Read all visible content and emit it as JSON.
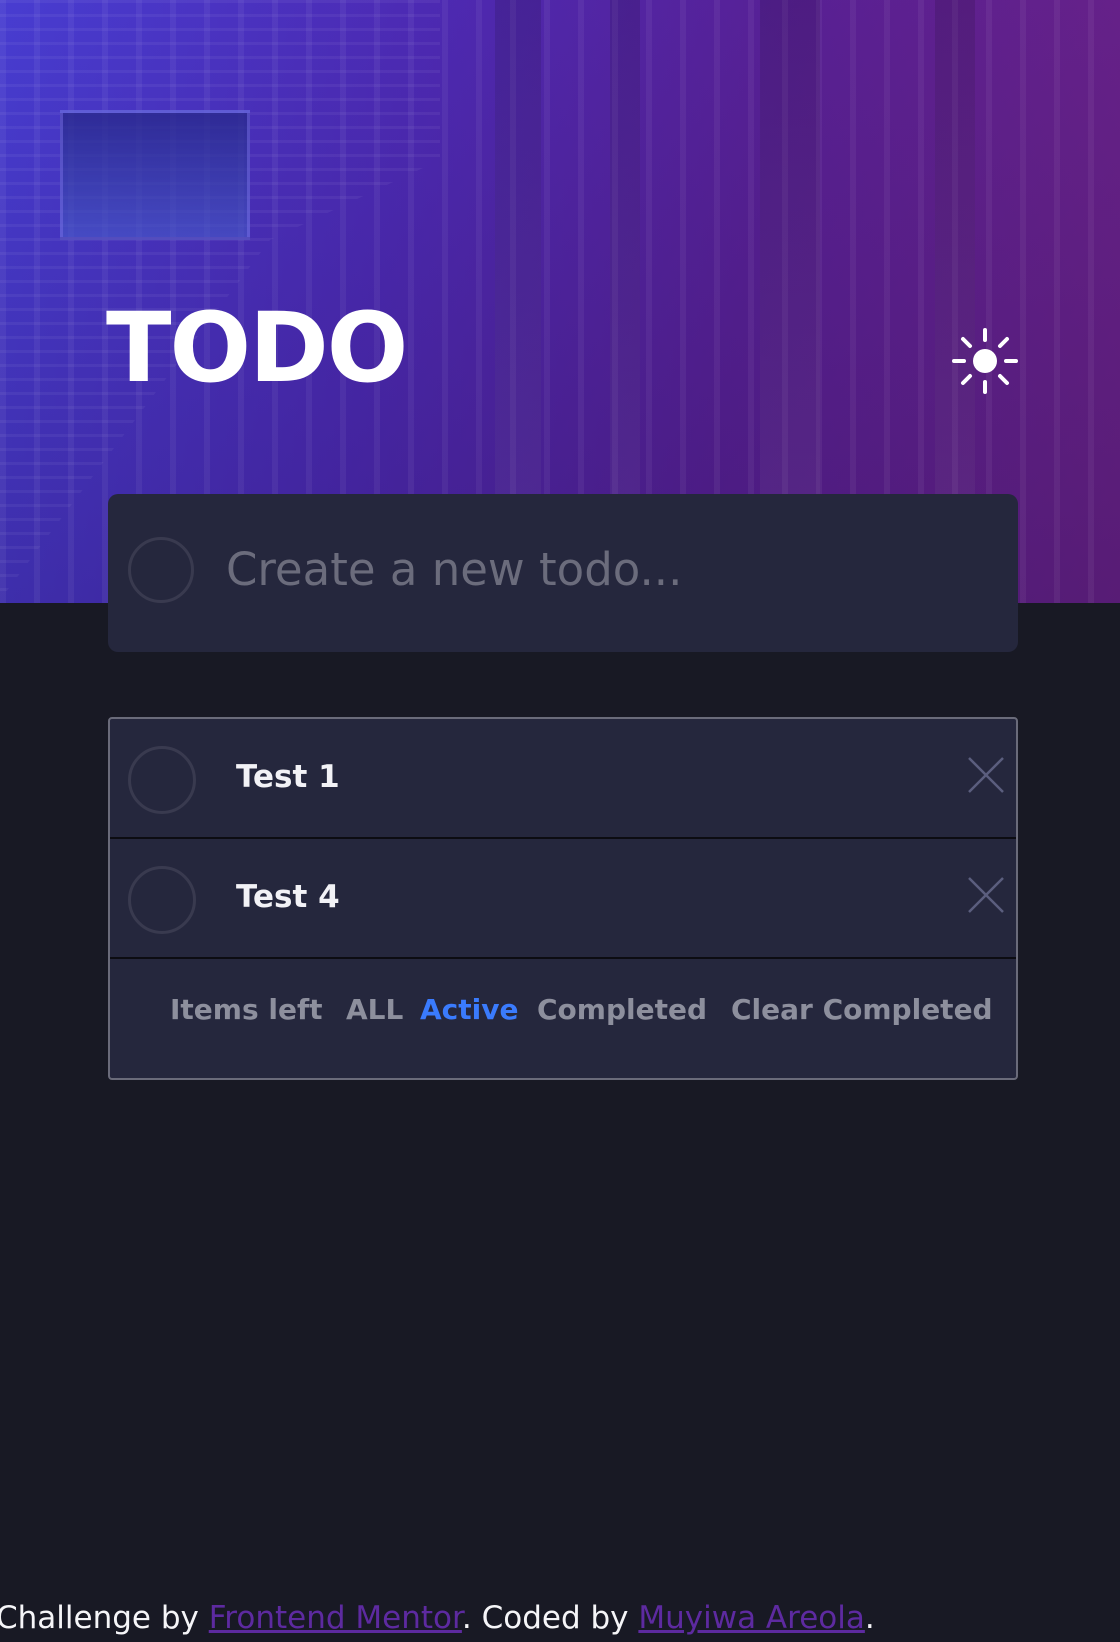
{
  "header": {
    "title": "TODO",
    "theme_icon": "sun-icon"
  },
  "create": {
    "placeholder": "Create a new todo...",
    "value": ""
  },
  "todos": [
    {
      "text": "Test 1",
      "completed": false
    },
    {
      "text": "Test 4",
      "completed": false
    }
  ],
  "footer": {
    "items_left": "Items left",
    "filter_all": "ALL",
    "filter_active": "Active",
    "filter_completed": "Completed",
    "clear_completed": "Clear Completed",
    "active_filter": "Active"
  },
  "attribution": {
    "prefix": "Challenge by",
    "link1": "Frontend Mentor",
    "middle": ". Coded by",
    "link2": "Muyiwa Areola",
    "suffix": "."
  },
  "colors": {
    "background": "#181924",
    "card": "#25273d",
    "accent": "#3a7bfd",
    "muted": "#8d8f9d",
    "link": "#5d2aa0"
  }
}
